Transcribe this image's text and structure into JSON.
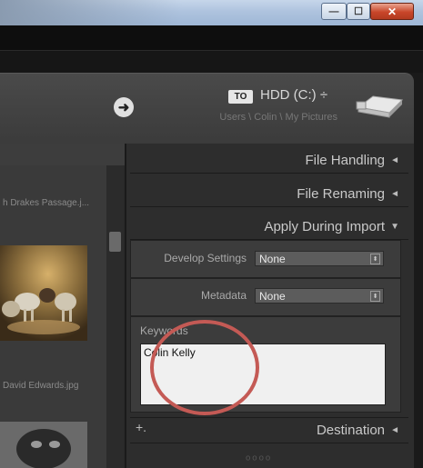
{
  "window": {
    "minimize_glyph": "—",
    "maximize_glyph": "☐",
    "close_glyph": "✕"
  },
  "header": {
    "to_badge": "TO",
    "destination_title": "HDD (C:) ÷",
    "destination_path": "Users \\ Colin \\ My Pictures",
    "arrow_glyph": "➜"
  },
  "grid": {
    "items": [
      {
        "filename": "h Drakes Passage.j..."
      },
      {
        "filename": "David Edwards.jpg"
      }
    ]
  },
  "panel": {
    "sections": [
      {
        "label": "File Handling",
        "state": "◄"
      },
      {
        "label": "File Renaming",
        "state": "◄"
      },
      {
        "label": "Apply During Import",
        "state": "▼"
      }
    ],
    "develop_settings": {
      "label": "Develop Settings",
      "value": "None"
    },
    "metadata": {
      "label": "Metadata",
      "value": "None"
    },
    "keywords": {
      "label": "Keywords",
      "value": "Colin Kelly"
    },
    "destination": {
      "label": "Destination",
      "state": "◄",
      "plus": "+."
    },
    "ornament": "ᵒᵒᵒᵒ"
  },
  "colors": {
    "accent_circle": "#c45a55",
    "panel_bg": "#2d2d2d",
    "header_bg": "#444444"
  }
}
